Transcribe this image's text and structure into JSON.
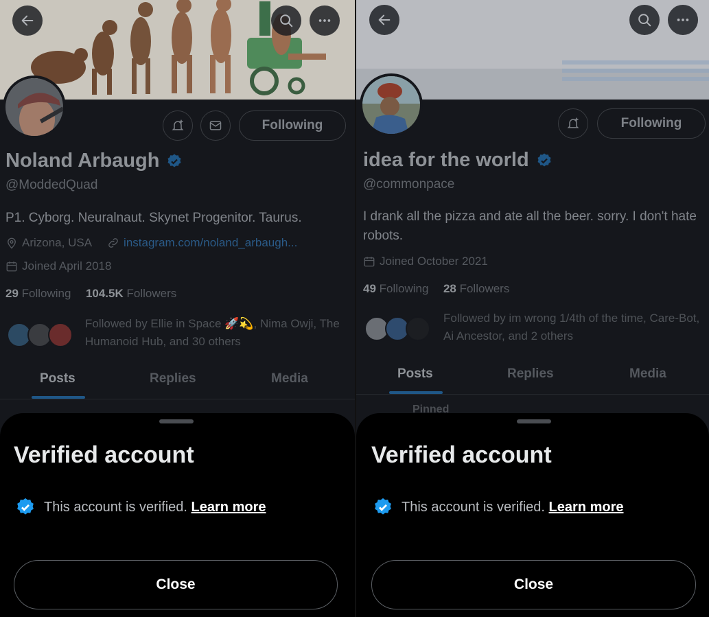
{
  "colors": {
    "verified_blue": "#1d9bf0",
    "sheet_background": "#000000",
    "profile_background": "#15171c"
  },
  "icons": {
    "back": "arrow-left-icon",
    "search": "search-icon",
    "more": "more-icon",
    "notifications": "bell-plus-icon",
    "message": "mail-icon",
    "location": "location-pin-icon",
    "link": "link-icon",
    "calendar": "calendar-icon",
    "verified": "verified-badge-icon"
  },
  "left": {
    "profile": {
      "name": "Noland Arbaugh",
      "handle": "@ModdedQuad",
      "bio": "P1. Cyborg. Neuralnaut. Skynet Progenitor. Taurus.",
      "location": "Arizona, USA",
      "link": "instagram.com/noland_arbaugh...",
      "joined": "Joined April 2018",
      "following_count": "29",
      "following_label": "Following",
      "followers_count": "104.5K",
      "followers_label": "Followers",
      "followed_by": "Followed by Ellie in Space 🚀💫, Nima Owji, The Humanoid Hub, and 30 others",
      "following_button": "Following"
    },
    "tabs": [
      "Posts",
      "Replies",
      "Media"
    ],
    "sheet": {
      "title": "Verified account",
      "message": "This account is verified.",
      "learn_more": "Learn more",
      "close": "Close"
    }
  },
  "right": {
    "profile": {
      "name": "idea for the world",
      "handle": "@commonpace",
      "bio": "I drank all the pizza and ate all the beer. sorry. I don't hate robots.",
      "joined": "Joined October 2021",
      "following_count": "49",
      "following_label": "Following",
      "followers_count": "28",
      "followers_label": "Followers",
      "followed_by": "Followed by im wrong 1/4th of the time, Care-Bot, Ai Ancestor, and 2 others",
      "following_button": "Following",
      "pinned_peek": "Pinned"
    },
    "tabs": [
      "Posts",
      "Replies",
      "Media"
    ],
    "sheet": {
      "title": "Verified account",
      "message": "This account is verified.",
      "learn_more": "Learn more",
      "close": "Close"
    }
  }
}
